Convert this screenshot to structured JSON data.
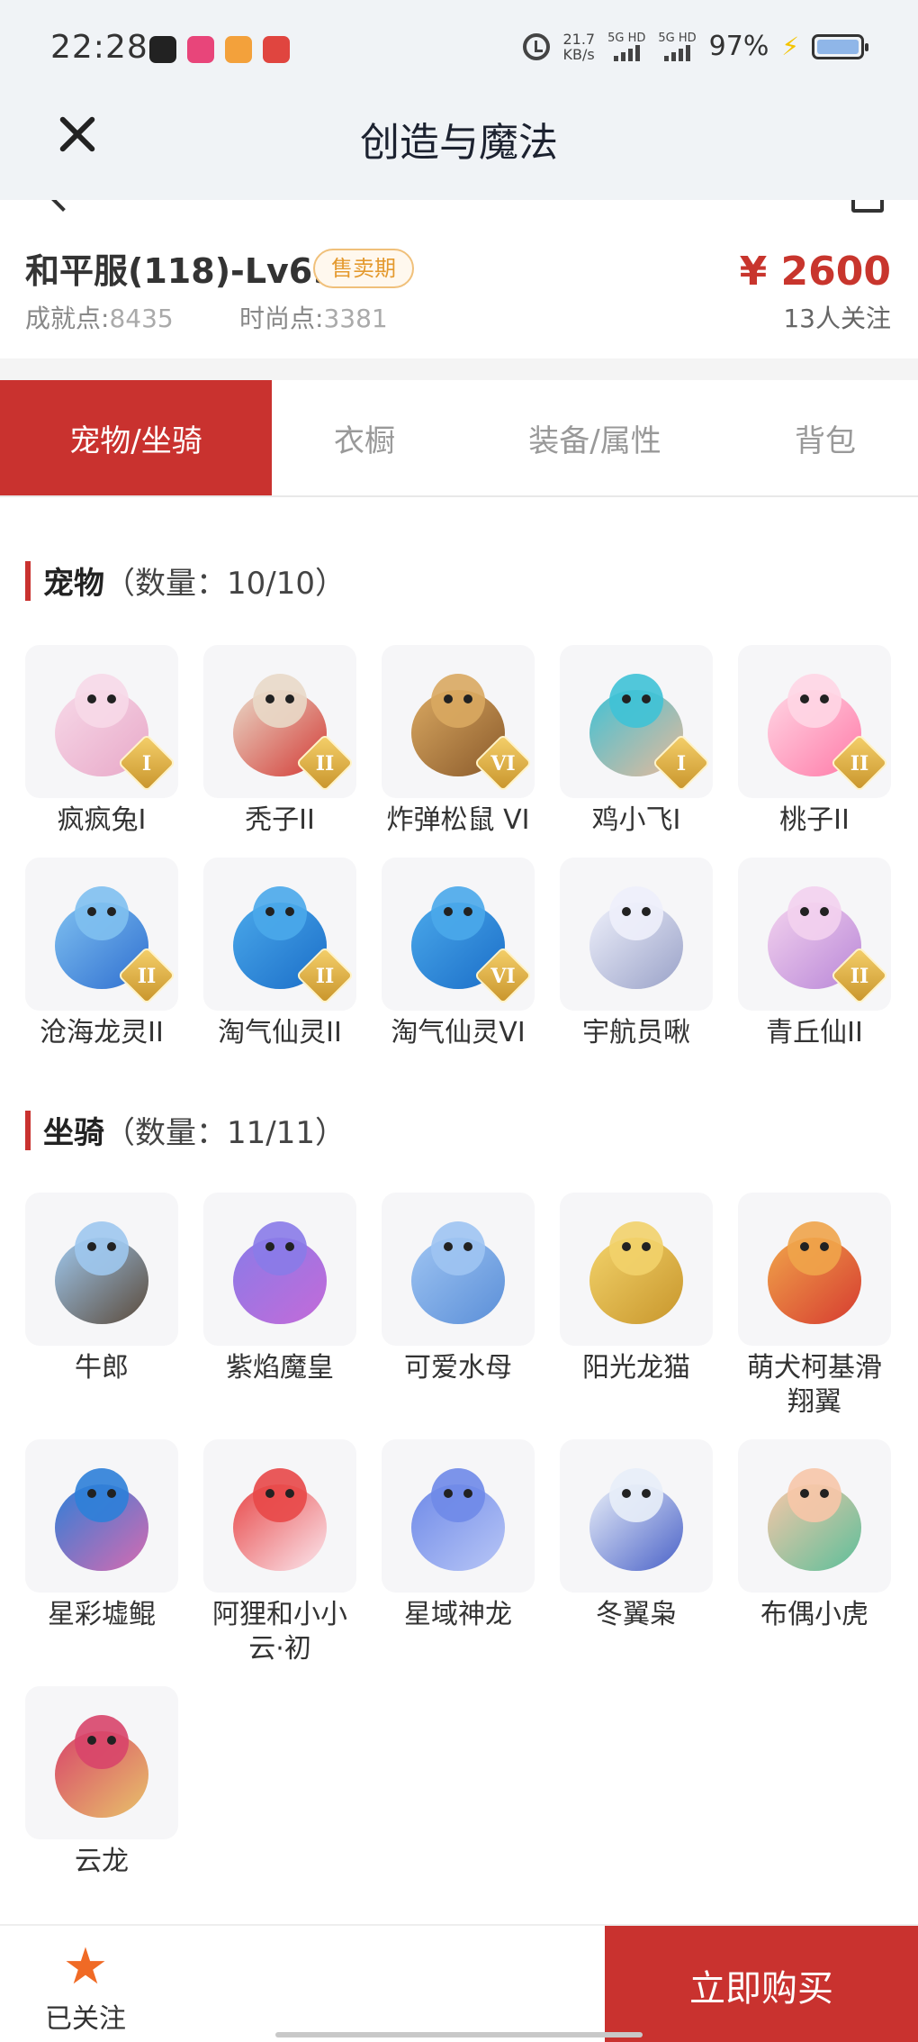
{
  "status_bar": {
    "time": "22:28",
    "speed_value": "21.7",
    "speed_unit": "KB/s",
    "sim1": "5G HD",
    "sim2": "5G HD",
    "battery": "97%",
    "app_icon_colors": [
      "#222222",
      "#e8457a",
      "#f3a13b",
      "#e0453f"
    ]
  },
  "title_bar": {
    "title": "创造与魔法",
    "close_icon": "close-icon"
  },
  "account": {
    "name": "和平服(118)-Lv69",
    "status_badge": "售卖期",
    "achievement_label": "成就点:",
    "achievement_value": "8435",
    "fashion_label": "时尚点:",
    "fashion_value": "3381",
    "price": "¥ 2600",
    "followers": "13人关注"
  },
  "tabs": [
    {
      "label": "宠物/坐骑",
      "active": true
    },
    {
      "label": "衣橱",
      "active": false
    },
    {
      "label": "装备/属性",
      "active": false
    },
    {
      "label": "背包",
      "active": false
    }
  ],
  "pets": {
    "title": "宠物",
    "count": "（数量：10/10）",
    "items": [
      {
        "name": "疯疯兔I",
        "tier": "I",
        "colors": [
          "#f7d9e8",
          "#e8a8c8"
        ]
      },
      {
        "name": "秃子II",
        "tier": "II",
        "colors": [
          "#e9d9c8",
          "#d33a35"
        ]
      },
      {
        "name": "炸弹松鼠 VI",
        "tier": "VI",
        "colors": [
          "#d9a861",
          "#8a5a2b"
        ]
      },
      {
        "name": "鸡小飞I",
        "tier": "I",
        "colors": [
          "#3fc2d6",
          "#e8b99a"
        ]
      },
      {
        "name": "桃子II",
        "tier": "II",
        "colors": [
          "#ffd6e4",
          "#ff7aa8"
        ]
      },
      {
        "name": "沧海龙灵II",
        "tier": "II",
        "colors": [
          "#7fc0f0",
          "#2f6fd0"
        ]
      },
      {
        "name": "淘气仙灵II",
        "tier": "II",
        "colors": [
          "#4aa8ea",
          "#1b6ec8"
        ]
      },
      {
        "name": "淘气仙灵VI",
        "tier": "VI",
        "colors": [
          "#4aa8ea",
          "#1b6ec8"
        ]
      },
      {
        "name": "宇航员啾",
        "tier": "",
        "colors": [
          "#eef0fb",
          "#9aa2c8"
        ]
      },
      {
        "name": "青丘仙II",
        "tier": "II",
        "colors": [
          "#f3d2ee",
          "#b987d8"
        ]
      }
    ]
  },
  "mounts": {
    "title": "坐骑",
    "count": "（数量：11/11）",
    "items": [
      {
        "name": "牛郎",
        "colors": [
          "#9fc8ee",
          "#5b4a3a"
        ]
      },
      {
        "name": "紫焰魔皇",
        "colors": [
          "#8a7be8",
          "#c46ad8"
        ]
      },
      {
        "name": "可爱水母",
        "colors": [
          "#9ec4f2",
          "#5b8fd8"
        ]
      },
      {
        "name": "阳光龙猫",
        "colors": [
          "#f2d26a",
          "#c8962c"
        ]
      },
      {
        "name": "萌犬柯基滑翔翼",
        "colors": [
          "#f0a44a",
          "#d63b30"
        ]
      },
      {
        "name": "星彩墟鲲",
        "colors": [
          "#2e7fd8",
          "#d86ab0"
        ]
      },
      {
        "name": "阿狸和小小云·初",
        "colors": [
          "#e84848",
          "#fbe8ef"
        ]
      },
      {
        "name": "星域神龙",
        "colors": [
          "#6f8ae8",
          "#b8c6f6"
        ]
      },
      {
        "name": "冬翼枭",
        "colors": [
          "#e8eef8",
          "#4a62c8"
        ]
      },
      {
        "name": "布偶小虎",
        "colors": [
          "#f7c7a8",
          "#5cbf9a"
        ]
      },
      {
        "name": "云龙",
        "colors": [
          "#d8456a",
          "#e8c36a"
        ]
      }
    ]
  },
  "bottom_bar": {
    "fav_label": "已关注",
    "buy_label": "立即购买"
  },
  "accent_color": "#c9322f"
}
